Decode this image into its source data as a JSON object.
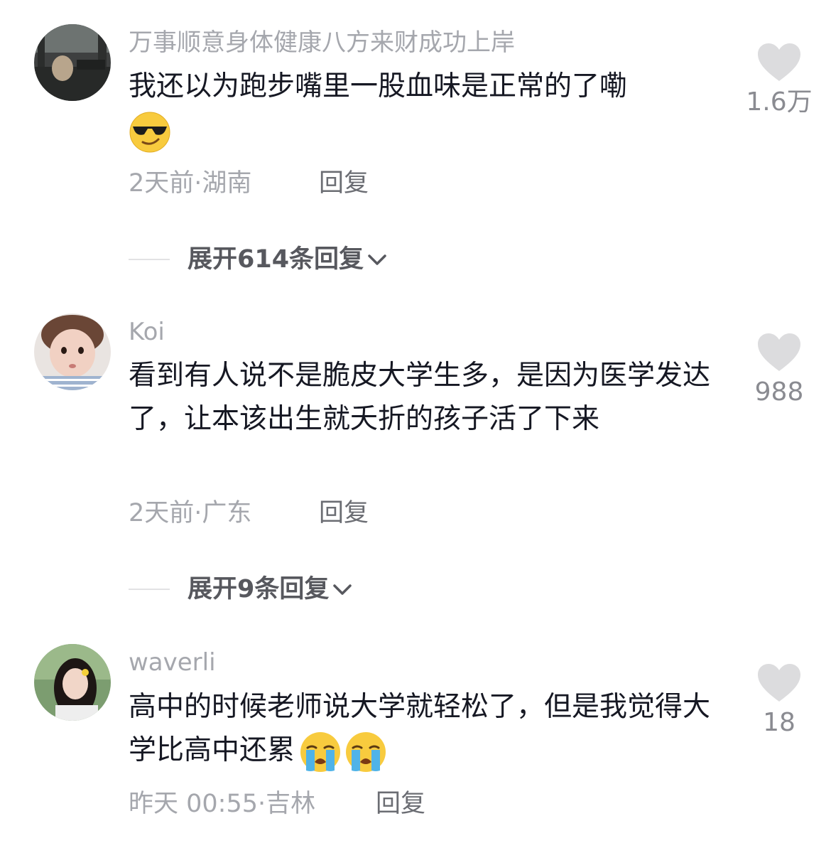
{
  "comments": [
    {
      "username": "万事顺意身体健康八方来财成功上岸",
      "text": "我还以为跑步嘴里一股血味是正常的了嘞",
      "emojis": [
        "sunglasses-face"
      ],
      "time": "2天前",
      "location": "湖南",
      "reply_label": "回复",
      "likes": "1.6万",
      "expand_label": "展开614条回复"
    },
    {
      "username": "Koi",
      "text": "看到有人说不是脆皮大学生多，是因为医学发达了，让本该出生就夭折的孩子活了下来",
      "emojis": [],
      "time": "2天前",
      "location": "广东",
      "reply_label": "回复",
      "likes": "988",
      "expand_label": "展开9条回复"
    },
    {
      "username": "waverli",
      "text": "高中的时候老师说大学就轻松了，但是我觉得大学比高中还累",
      "emojis": [
        "loudly-crying-face",
        "loudly-crying-face"
      ],
      "time": "昨天 00:55",
      "location": "吉林",
      "reply_label": "回复",
      "likes": "18"
    }
  ],
  "separator": "·",
  "colors": {
    "primary_text": "#161823",
    "secondary_text": "#a5a7ad",
    "heart": "#dcdcde"
  }
}
